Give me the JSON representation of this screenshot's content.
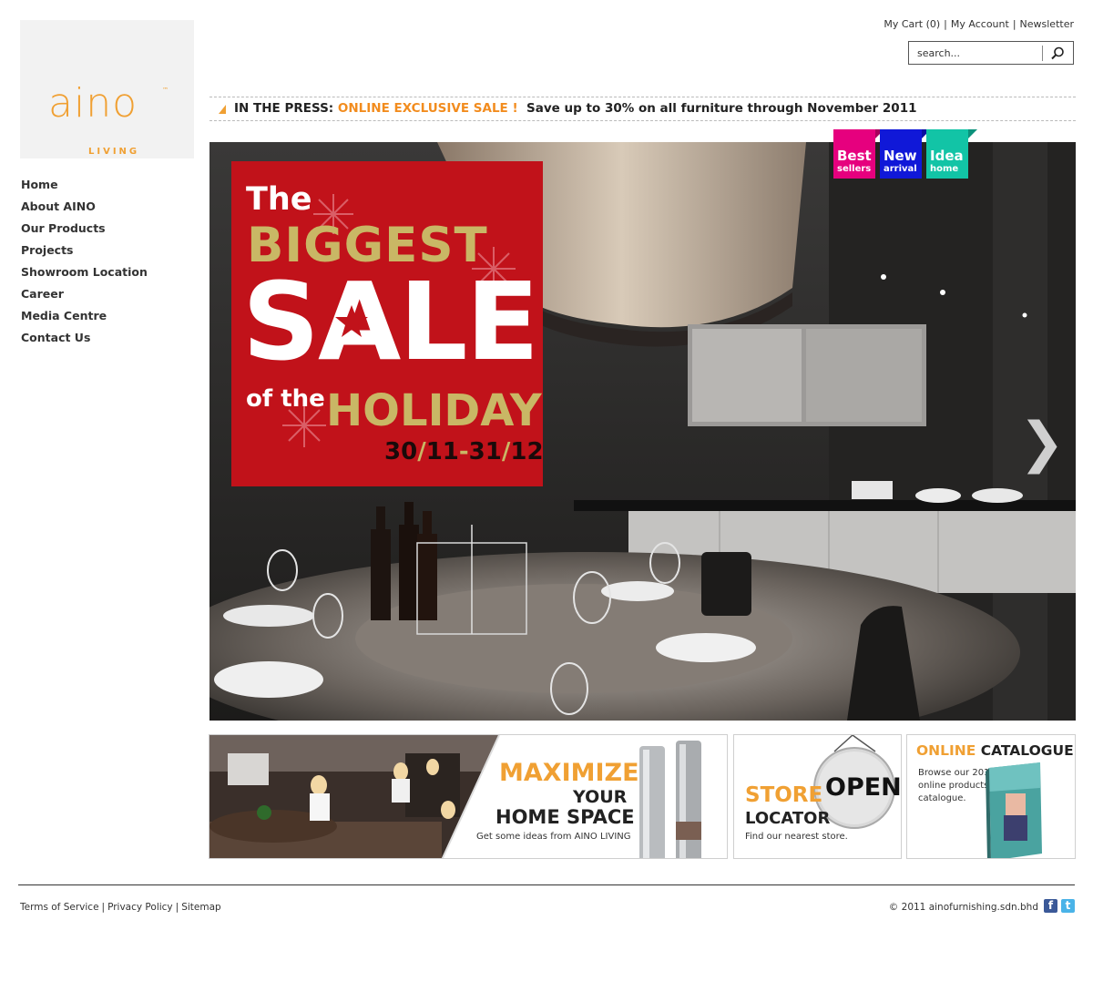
{
  "brand": {
    "name": "aino",
    "sub": "LIVING",
    "tm": "™"
  },
  "nav": {
    "items": [
      {
        "label": "Home"
      },
      {
        "label": "About AINO"
      },
      {
        "label": "Our Products"
      },
      {
        "label": "Projects"
      },
      {
        "label": "Showroom Location"
      },
      {
        "label": "Career"
      },
      {
        "label": "Media Centre"
      },
      {
        "label": "Contact Us"
      }
    ]
  },
  "toplinks": {
    "cart": "My Cart (0)",
    "account": "My Account",
    "newsletter": "Newsletter"
  },
  "search": {
    "value": "search..."
  },
  "press": {
    "prefix": "IN THE PRESS:",
    "highlight": "ONLINE EXCLUSIVE SALE !",
    "text": "Save up to 30% on all furniture through November 2011"
  },
  "hero": {
    "line1": "The",
    "line2": "BIGGEST",
    "line3": "SALE",
    "line4": "of the",
    "line5": "HOLIDAY",
    "dates": {
      "d1": "30",
      "d2": "11",
      "dash": "-",
      "d3": "31",
      "d4": "12",
      "slash": "/"
    },
    "next": "❯"
  },
  "tags": [
    {
      "top": "Best",
      "bottom": "sellers",
      "color": "#e6007e"
    },
    {
      "top": "New",
      "bottom": "arrival",
      "color": "#1018d8"
    },
    {
      "top": "Idea",
      "bottom": "home",
      "color": "#12c4a6"
    }
  ],
  "banners": {
    "maximize": {
      "l1": "MAXIMIZE",
      "l2": "YOUR",
      "l3": "HOME SPACE",
      "l4": "Get some ideas from AINO LIVING"
    },
    "store": {
      "sign": "OPEN",
      "l1": "STORE",
      "l2": "LOCATOR",
      "l3": "Find our nearest store."
    },
    "catalogue": {
      "t1": "ONLINE",
      "t2": "CATALOGUE",
      "desc": "Browse our 2011 online products catalogue."
    }
  },
  "footer": {
    "terms": "Terms of Service",
    "privacy": "Privacy Policy",
    "sitemap": "Sitemap",
    "copyright": "© 2011 ainofurnishing.sdn.bhd"
  },
  "colors": {
    "accent": "#f0a033",
    "sale_red": "#c1121a",
    "gold": "#c9b765"
  }
}
